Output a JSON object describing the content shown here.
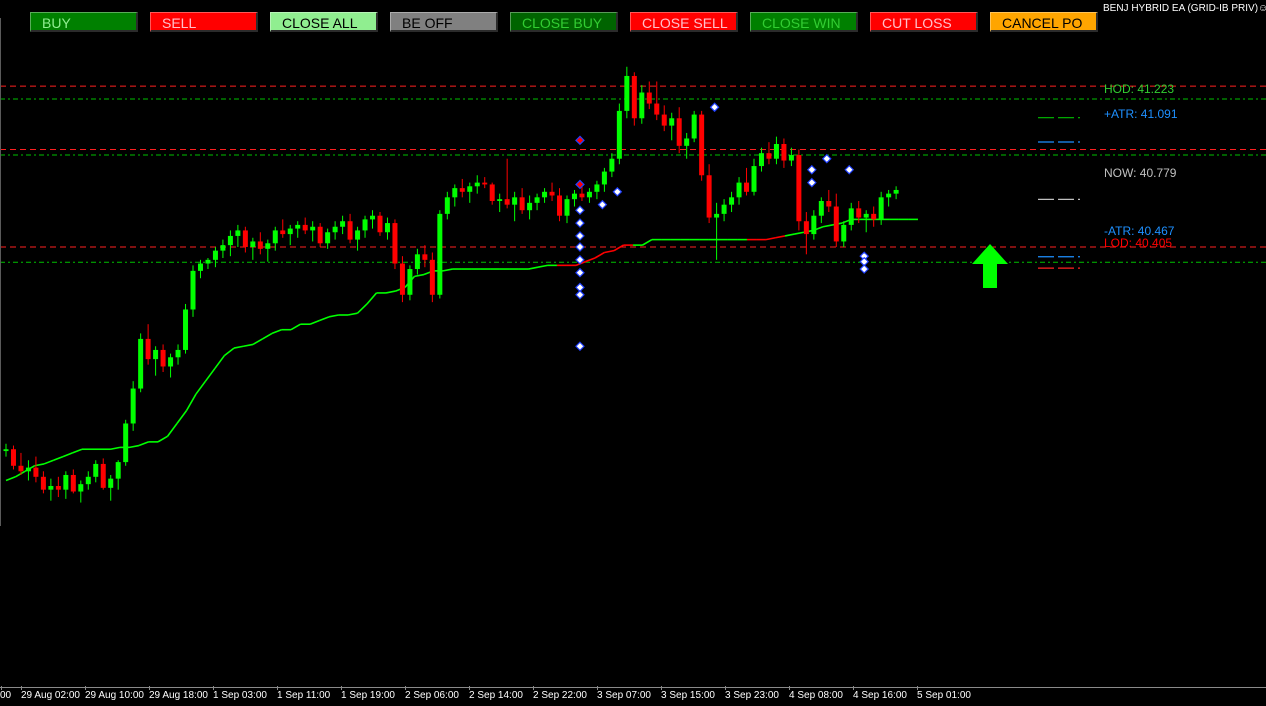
{
  "toolbar": {
    "buttons": [
      {
        "label": "BUY",
        "bg": "#008000",
        "fg": "#90ee90"
      },
      {
        "label": "SELL",
        "bg": "#ff0000",
        "fg": "#ffc0cb"
      },
      {
        "label": "CLOSE ALL",
        "bg": "#90ee90",
        "fg": "#000000"
      },
      {
        "label": "BE OFF",
        "bg": "#808080",
        "fg": "#000000"
      },
      {
        "label": "CLOSE BUY",
        "bg": "#006400",
        "fg": "#32cd32"
      },
      {
        "label": "CLOSE SELL",
        "bg": "#ff0000",
        "fg": "#ffc0cb"
      },
      {
        "label": "CLOSE WIN",
        "bg": "#008000",
        "fg": "#32cd32"
      },
      {
        "label": "CUT LOSS",
        "bg": "#ff0000",
        "fg": "#ffc0cb"
      },
      {
        "label": "CANCEL PO",
        "bg": "#ffa500",
        "fg": "#000000"
      }
    ]
  },
  "ea_title": "BENJ HYBRID EA (GRID-IB PRIV)",
  "ea_title_icon": "smiley-icon",
  "levels": {
    "hod": {
      "text": "HOD: 41.223",
      "color": "#32cd32"
    },
    "atr_plus": {
      "text": "+ATR: 41.091",
      "color": "#1e90ff"
    },
    "now": {
      "text": "NOW: 40.779",
      "color": "#c0c0c0"
    },
    "atr_minus": {
      "text": "-ATR: 40.467",
      "color": "#1e90ff"
    },
    "lod": {
      "text": "LOD: 40.405",
      "color": "#ff0000"
    }
  },
  "signal": {
    "icon": "up-arrow-icon",
    "color": "#00ff00"
  },
  "x_axis": {
    "labels": [
      "00",
      "29 Aug 02:00",
      "29 Aug 10:00",
      "29 Aug 18:00",
      "1 Sep 03:00",
      "1 Sep 11:00",
      "1 Sep 19:00",
      "2 Sep 06:00",
      "2 Sep 14:00",
      "2 Sep 22:00",
      "3 Sep 07:00",
      "3 Sep 15:00",
      "3 Sep 23:00",
      "4 Sep 08:00",
      "4 Sep 16:00",
      "5 Sep 01:00"
    ]
  },
  "chart_data": {
    "type": "candlestick",
    "bull_color": "#00ff00",
    "bear_color": "#ff0000",
    "trail_up_color": "#00ff00",
    "trail_down_color": "#ff0000",
    "ylim": [
      38.6,
      41.7
    ],
    "price_levels": [
      41.223,
      41.091,
      40.779,
      40.467,
      40.405
    ],
    "candles": [
      [
        39.41,
        39.45,
        39.38,
        39.42
      ],
      [
        39.42,
        39.44,
        39.31,
        39.33
      ],
      [
        39.33,
        39.4,
        39.28,
        39.3
      ],
      [
        39.3,
        39.36,
        39.25,
        39.32
      ],
      [
        39.32,
        39.38,
        39.24,
        39.27
      ],
      [
        39.27,
        39.3,
        39.18,
        39.2
      ],
      [
        39.2,
        39.26,
        39.14,
        39.22
      ],
      [
        39.22,
        39.27,
        39.16,
        39.2
      ],
      [
        39.2,
        39.3,
        39.15,
        39.28
      ],
      [
        39.28,
        39.31,
        39.18,
        39.19
      ],
      [
        39.19,
        39.25,
        39.13,
        39.23
      ],
      [
        39.23,
        39.3,
        39.2,
        39.27
      ],
      [
        39.27,
        39.36,
        39.24,
        39.34
      ],
      [
        39.34,
        39.37,
        39.2,
        39.21
      ],
      [
        39.21,
        39.28,
        39.14,
        39.26
      ],
      [
        39.26,
        39.36,
        39.2,
        39.35
      ],
      [
        39.35,
        39.58,
        39.33,
        39.56
      ],
      [
        39.56,
        39.79,
        39.52,
        39.75
      ],
      [
        39.75,
        40.05,
        39.73,
        40.02
      ],
      [
        40.02,
        40.1,
        39.88,
        39.91
      ],
      [
        39.91,
        39.98,
        39.82,
        39.96
      ],
      [
        39.96,
        39.99,
        39.84,
        39.87
      ],
      [
        39.87,
        39.94,
        39.81,
        39.92
      ],
      [
        39.92,
        39.99,
        39.88,
        39.96
      ],
      [
        39.96,
        40.21,
        39.94,
        40.18
      ],
      [
        40.18,
        40.42,
        40.14,
        40.39
      ],
      [
        40.39,
        40.45,
        40.35,
        40.43
      ],
      [
        40.43,
        40.46,
        40.4,
        40.45
      ],
      [
        40.45,
        40.52,
        40.41,
        40.5
      ],
      [
        40.5,
        40.56,
        40.46,
        40.53
      ],
      [
        40.53,
        40.61,
        40.47,
        40.58
      ],
      [
        40.58,
        40.64,
        40.52,
        40.61
      ],
      [
        40.61,
        40.63,
        40.49,
        40.52
      ],
      [
        40.52,
        40.57,
        40.45,
        40.55
      ],
      [
        40.55,
        40.6,
        40.48,
        40.51
      ],
      [
        40.51,
        40.56,
        40.44,
        40.54
      ],
      [
        40.54,
        40.63,
        40.5,
        40.61
      ],
      [
        40.61,
        40.67,
        40.57,
        40.59
      ],
      [
        40.59,
        40.64,
        40.53,
        40.62
      ],
      [
        40.62,
        40.66,
        40.57,
        40.64
      ],
      [
        40.64,
        40.68,
        40.59,
        40.61
      ],
      [
        40.61,
        40.66,
        40.55,
        40.63
      ],
      [
        40.63,
        40.65,
        40.52,
        40.54
      ],
      [
        40.54,
        40.62,
        40.51,
        40.6
      ],
      [
        40.6,
        40.66,
        40.56,
        40.63
      ],
      [
        40.63,
        40.69,
        40.59,
        40.66
      ],
      [
        40.66,
        40.7,
        40.54,
        40.56
      ],
      [
        40.56,
        40.63,
        40.5,
        40.61
      ],
      [
        40.61,
        40.69,
        40.57,
        40.67
      ],
      [
        40.67,
        40.72,
        40.62,
        40.69
      ],
      [
        40.69,
        40.71,
        40.58,
        40.6
      ],
      [
        40.6,
        40.68,
        40.56,
        40.65
      ],
      [
        40.65,
        40.67,
        40.4,
        40.43
      ],
      [
        40.43,
        40.47,
        40.22,
        40.26
      ],
      [
        40.26,
        40.42,
        40.23,
        40.4
      ],
      [
        40.4,
        40.51,
        40.37,
        40.48
      ],
      [
        40.48,
        40.53,
        40.41,
        40.45
      ],
      [
        40.45,
        40.49,
        40.22,
        40.26
      ],
      [
        40.26,
        40.72,
        40.24,
        40.7
      ],
      [
        40.7,
        40.82,
        40.67,
        40.79
      ],
      [
        40.79,
        40.86,
        40.74,
        40.84
      ],
      [
        40.84,
        40.89,
        40.79,
        40.82
      ],
      [
        40.82,
        40.87,
        40.76,
        40.85
      ],
      [
        40.85,
        40.91,
        40.81,
        40.87
      ],
      [
        40.87,
        40.9,
        40.84,
        40.86
      ],
      [
        40.86,
        40.87,
        40.75,
        40.77
      ],
      [
        40.77,
        40.81,
        40.71,
        40.78
      ],
      [
        40.78,
        41.0,
        40.73,
        40.75
      ],
      [
        40.75,
        40.82,
        40.66,
        40.79
      ],
      [
        40.79,
        40.84,
        40.7,
        40.72
      ],
      [
        40.72,
        40.8,
        40.67,
        40.76
      ],
      [
        40.76,
        40.81,
        40.72,
        40.79
      ],
      [
        40.79,
        40.84,
        40.76,
        40.82
      ],
      [
        40.82,
        40.87,
        40.77,
        40.8
      ],
      [
        40.8,
        40.84,
        40.66,
        40.69
      ],
      [
        40.69,
        40.8,
        40.65,
        40.78
      ],
      [
        40.78,
        40.83,
        40.74,
        40.81
      ],
      [
        40.81,
        40.85,
        40.77,
        40.79
      ],
      [
        40.79,
        40.84,
        40.76,
        40.82
      ],
      [
        40.82,
        40.88,
        40.78,
        40.86
      ],
      [
        40.86,
        40.95,
        40.82,
        40.93
      ],
      [
        40.93,
        41.03,
        40.9,
        41.0
      ],
      [
        41.0,
        41.3,
        40.97,
        41.26
      ],
      [
        41.26,
        41.5,
        41.22,
        41.45
      ],
      [
        41.45,
        41.47,
        41.18,
        41.22
      ],
      [
        41.22,
        41.4,
        41.19,
        41.36
      ],
      [
        41.36,
        41.42,
        41.27,
        41.3
      ],
      [
        41.3,
        41.42,
        41.21,
        41.24
      ],
      [
        41.24,
        41.29,
        41.15,
        41.18
      ],
      [
        41.18,
        41.25,
        41.1,
        41.22
      ],
      [
        41.22,
        41.28,
        41.03,
        41.07
      ],
      [
        41.07,
        41.14,
        41.0,
        41.11
      ],
      [
        41.11,
        41.26,
        41.09,
        41.24
      ],
      [
        41.24,
        41.26,
        40.88,
        40.91
      ],
      [
        40.91,
        40.97,
        40.65,
        40.68
      ],
      [
        40.68,
        40.76,
        40.45,
        40.7
      ],
      [
        40.7,
        40.78,
        40.66,
        40.75
      ],
      [
        40.75,
        40.82,
        40.71,
        40.79
      ],
      [
        40.79,
        40.9,
        40.75,
        40.87
      ],
      [
        40.87,
        40.95,
        40.8,
        40.82
      ],
      [
        40.82,
        41.0,
        40.8,
        40.96
      ],
      [
        40.96,
        41.06,
        40.93,
        41.03
      ],
      [
        41.03,
        41.09,
        40.97,
        41.0
      ],
      [
        41.0,
        41.12,
        40.97,
        41.08
      ],
      [
        41.08,
        41.11,
        40.95,
        40.99
      ],
      [
        40.99,
        41.06,
        40.96,
        41.02
      ],
      [
        41.02,
        41.05,
        40.61,
        40.66
      ],
      [
        40.66,
        40.71,
        40.48,
        40.59
      ],
      [
        40.59,
        40.72,
        40.56,
        40.69
      ],
      [
        40.69,
        40.79,
        40.65,
        40.77
      ],
      [
        40.77,
        40.83,
        40.71,
        40.74
      ],
      [
        40.74,
        40.81,
        40.52,
        40.55
      ],
      [
        40.55,
        40.66,
        40.52,
        40.64
      ],
      [
        40.64,
        40.76,
        40.61,
        40.73
      ],
      [
        40.73,
        40.77,
        40.65,
        40.68
      ],
      [
        40.68,
        40.72,
        40.6,
        40.7
      ],
      [
        40.7,
        40.74,
        40.63,
        40.67
      ],
      [
        40.67,
        40.82,
        40.64,
        40.79
      ],
      [
        40.79,
        40.83,
        40.74,
        40.81
      ],
      [
        40.81,
        40.85,
        40.78,
        40.83
      ]
    ],
    "trail": [
      [
        39.25,
        39.27,
        39.3,
        39.33,
        39.34,
        39.36,
        39.38,
        39.4,
        39.42,
        39.42,
        39.42,
        39.42,
        39.43,
        39.43,
        39.44,
        39.46,
        39.46,
        39.49,
        39.56,
        39.63,
        39.72,
        39.79,
        39.86,
        39.93,
        39.97,
        39.98,
        39.99,
        40.02,
        40.05,
        40.07,
        40.07,
        40.1,
        40.1,
        40.12,
        40.14,
        40.15,
        40.15,
        40.16,
        40.21,
        40.27,
        40.27,
        40.28,
        40.3,
        40.36,
        40.37,
        40.39,
        40.39,
        40.4,
        40.4,
        40.4,
        40.4,
        40.4,
        40.4,
        40.4,
        40.4,
        40.4,
        40.41,
        40.42,
        40.42,
        40.42,
        40.42,
        40.44,
        40.46,
        40.49,
        40.5,
        40.53,
        40.53,
        40.53,
        40.56,
        40.56,
        40.56,
        40.56,
        40.56,
        40.56,
        40.56,
        40.56,
        40.56,
        40.56,
        40.56,
        40.56,
        40.56,
        40.57,
        40.58,
        40.59,
        40.6,
        40.61,
        40.63,
        40.64,
        40.65,
        40.67,
        40.67,
        40.67,
        40.67,
        40.67,
        40.67,
        40.67,
        40.67
      ]
    ]
  }
}
